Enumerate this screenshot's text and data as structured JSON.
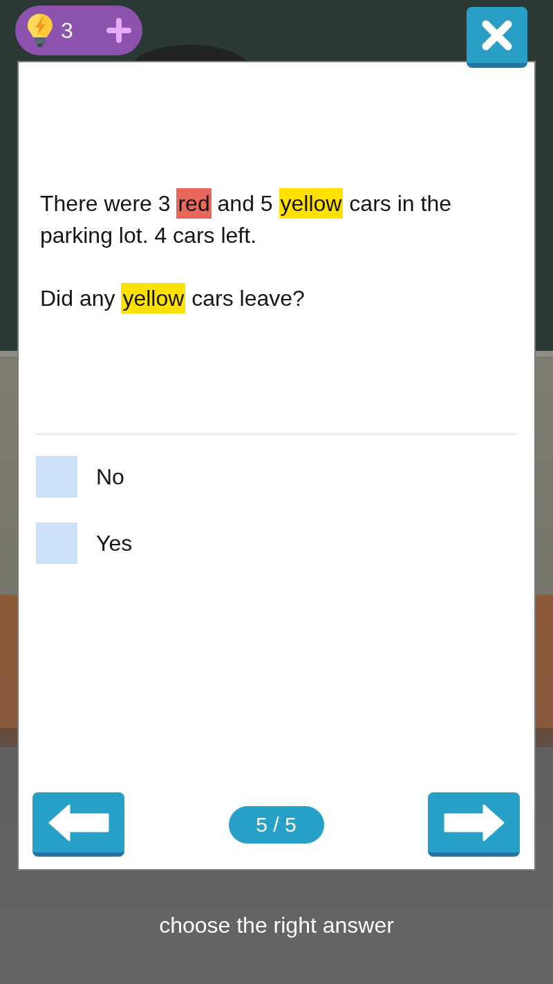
{
  "hints": {
    "count": "3"
  },
  "question": {
    "paragraphs": [
      {
        "segments": [
          {
            "text": "There were 3 "
          },
          {
            "text": "red",
            "color": "#e8675a"
          },
          {
            "text": " and 5 "
          },
          {
            "text": "yellow",
            "color": "#ffe100"
          },
          {
            "text": " cars in the parking lot. 4 cars left."
          }
        ]
      },
      {
        "segments": [
          {
            "text": "Did any "
          },
          {
            "text": "yellow",
            "color": "#ffe100"
          },
          {
            "text": " cars leave?"
          }
        ]
      }
    ]
  },
  "options": [
    {
      "label": "No",
      "selected": false
    },
    {
      "label": "Yes",
      "selected": false
    }
  ],
  "pager": {
    "position": "5 / 5"
  },
  "instruction": "choose the right answer"
}
